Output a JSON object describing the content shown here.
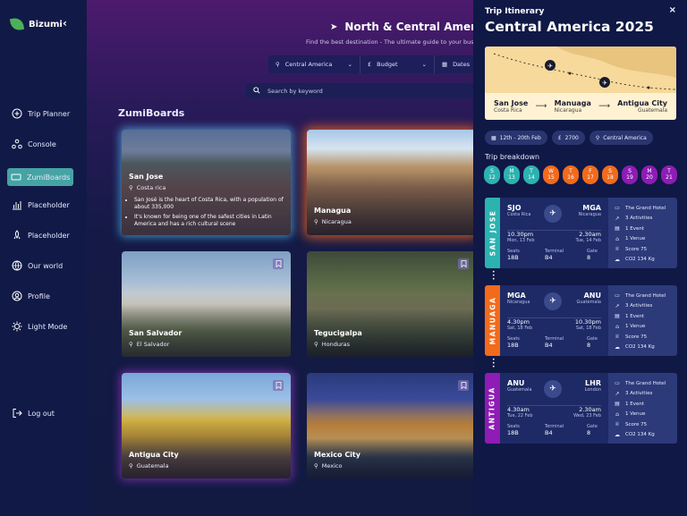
{
  "app": {
    "name": "Bizumi"
  },
  "sidebar": {
    "items": [
      {
        "label": "Trip Planner",
        "icon": "plus-circle-icon"
      },
      {
        "label": "Console",
        "icon": "network-icon"
      },
      {
        "label": "ZumiBoards",
        "icon": "board-icon",
        "active": true
      },
      {
        "label": "Placeholder",
        "icon": "bar-chart-icon"
      },
      {
        "label": "Placeholder",
        "icon": "rocket-icon"
      },
      {
        "label": "Our world",
        "icon": "globe-icon"
      },
      {
        "label": "Profile",
        "icon": "user-icon"
      },
      {
        "label": "Light Mode",
        "icon": "sun-icon"
      }
    ],
    "logout": "Log out"
  },
  "header": {
    "title": "North & Central America",
    "subtitle": "Find the best destination - The ultimate guide to your busin",
    "filters": {
      "region": "Central America",
      "budget": "Budget",
      "dates": "Dates"
    },
    "search_placeholder": "Search by keyword"
  },
  "boards": {
    "title": "ZumiBoards",
    "cards": [
      {
        "name": "San Jose",
        "country": "Costa rica",
        "facts": [
          "San José is the heart of Costa Rica, with a population of about 335,000",
          "It's known for being one of the safest cities in Latin America and has a rich cultural scene"
        ]
      },
      {
        "name": "Managua",
        "country": "Nicaragua"
      },
      {
        "name": "San Salvador",
        "country": "El Salvador"
      },
      {
        "name": "Tegucigalpa",
        "country": "Honduras"
      },
      {
        "name": "Antigua City",
        "country": "Guatemala"
      },
      {
        "name": "Mexico City",
        "country": "Mexico"
      }
    ]
  },
  "itinerary": {
    "label": "Trip Itinerary",
    "title": "Central America 2025",
    "stops": [
      {
        "city": "San Jose",
        "country": "Costa Rica"
      },
      {
        "city": "Manuaga",
        "country": "Nicaragua"
      },
      {
        "city": "Antigua City",
        "country": "Guatemala"
      }
    ],
    "chips": {
      "dates": "12th - 20th Feb",
      "budget": "2700",
      "region": "Central America"
    },
    "breakdown_title": "Trip breakdown",
    "days": [
      {
        "d": "S",
        "n": "12",
        "color": "#2bb3b0"
      },
      {
        "d": "M",
        "n": "13",
        "color": "#2bb3b0"
      },
      {
        "d": "T",
        "n": "14",
        "color": "#2bb3b0"
      },
      {
        "d": "W",
        "n": "15",
        "color": "#f26a1b"
      },
      {
        "d": "T",
        "n": "16",
        "color": "#f26a1b"
      },
      {
        "d": "F",
        "n": "17",
        "color": "#f26a1b"
      },
      {
        "d": "S",
        "n": "18",
        "color": "#f26a1b"
      },
      {
        "d": "S",
        "n": "19",
        "color": "#8e1cb5"
      },
      {
        "d": "M",
        "n": "20",
        "color": "#8e1cb5"
      },
      {
        "d": "T",
        "n": "21",
        "color": "#8e1cb5"
      }
    ],
    "segments": [
      {
        "side": "SAN JOSE",
        "color": "#2bb3b0",
        "from": {
          "code": "SJO",
          "city": "Costa Rica",
          "time": "10.30pm",
          "date": "Mon, 13 Feb"
        },
        "to": {
          "code": "MGA",
          "city": "Nicaragua",
          "time": "2.30am",
          "date": "Tue, 14 Feb"
        },
        "seats_label": "Seats",
        "seats": "18B",
        "terminal_label": "Terminal",
        "terminal": "B4",
        "gate_label": "Gate",
        "gate": "8",
        "info": [
          "The Grand Hotel",
          "3 Activities",
          "1 Event",
          "1 Venue",
          "Score 75",
          "CO2 134 Kg"
        ]
      },
      {
        "side": "MANUAGA",
        "color": "#f26a1b",
        "from": {
          "code": "MGA",
          "city": "Nicaragua",
          "time": "4.30pm",
          "date": "Sat, 18 Feb"
        },
        "to": {
          "code": "ANU",
          "city": "Guatemala",
          "time": "10.30pm",
          "date": "Sat, 18 Feb"
        },
        "seats_label": "Seats",
        "seats": "18B",
        "terminal_label": "Terminal",
        "terminal": "B4",
        "gate_label": "Gate",
        "gate": "8",
        "info": [
          "The Grand Hotel",
          "3 Activities",
          "1 Event",
          "1 Venue",
          "Score 75",
          "CO2 134 Kg"
        ]
      },
      {
        "side": "ANTIGUA",
        "color": "#8e1cb5",
        "from": {
          "code": "ANU",
          "city": "Guatemala",
          "time": "4.30am",
          "date": "Tue, 22 Feb"
        },
        "to": {
          "code": "LHR",
          "city": "London",
          "time": "2.30am",
          "date": "Wed, 23 Feb"
        },
        "seats_label": "Seats",
        "seats": "18B",
        "terminal_label": "Terminal",
        "terminal": "B4",
        "gate_label": "Gate",
        "gate": "8",
        "info": [
          "The Grand Hotel",
          "3 Activities",
          "1 Event",
          "1 Venue",
          "Score 75",
          "CO2 134 Kg"
        ]
      }
    ]
  }
}
